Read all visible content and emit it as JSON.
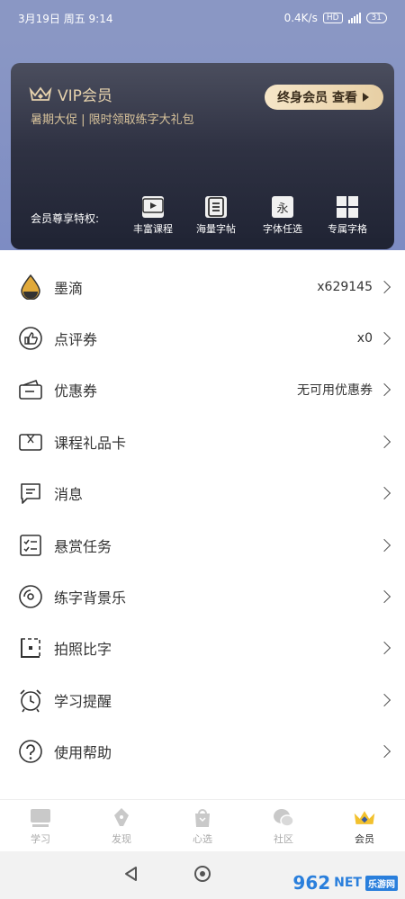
{
  "status": {
    "time": "3月19日 周五 9:14",
    "speed": "0.4K/s",
    "hd": "HD",
    "battery": "31"
  },
  "vip": {
    "title": "VIP会员",
    "subtitle": "暑期大促 | 限时领取练字大礼包",
    "button": "终身会员 查看",
    "privileges_label": "会员尊享特权:",
    "privileges": [
      {
        "label": "丰富课程",
        "icon": "video-icon"
      },
      {
        "label": "海量字帖",
        "icon": "document-icon"
      },
      {
        "label": "字体任选",
        "icon": "yong-character-icon",
        "glyph": "永"
      },
      {
        "label": "专属字格",
        "icon": "grid-icon"
      }
    ]
  },
  "menu": [
    {
      "label": "墨滴",
      "value": "x629145",
      "icon": "ink-drop-icon"
    },
    {
      "label": "点评券",
      "value": "x0",
      "icon": "thumbs-up-icon"
    },
    {
      "label": "优惠券",
      "value": "无可用优惠券",
      "icon": "coupon-icon"
    },
    {
      "label": "课程礼品卡",
      "value": "",
      "icon": "gift-card-icon"
    },
    {
      "label": "消息",
      "value": "",
      "icon": "message-icon"
    },
    {
      "label": "悬赏任务",
      "value": "",
      "icon": "task-list-icon"
    },
    {
      "label": "练字背景乐",
      "value": "",
      "icon": "music-disc-icon"
    },
    {
      "label": "拍照比字",
      "value": "",
      "icon": "camera-frame-icon"
    },
    {
      "label": "学习提醒",
      "value": "",
      "icon": "alarm-clock-icon"
    },
    {
      "label": "使用帮助",
      "value": "",
      "icon": "help-icon"
    }
  ],
  "tabs": [
    {
      "label": "学习",
      "icon": "learn-icon"
    },
    {
      "label": "发现",
      "icon": "pen-icon"
    },
    {
      "label": "心选",
      "icon": "bag-icon"
    },
    {
      "label": "社区",
      "icon": "chat-icon"
    },
    {
      "label": "会员",
      "icon": "crown-icon",
      "active": true
    }
  ],
  "watermark": {
    "brand": "962",
    "suffix": "NET",
    "sub": "乐游网"
  },
  "colors": {
    "header": "#8a97c4",
    "gold": "#e6d2ad",
    "card": "#2f3243"
  }
}
